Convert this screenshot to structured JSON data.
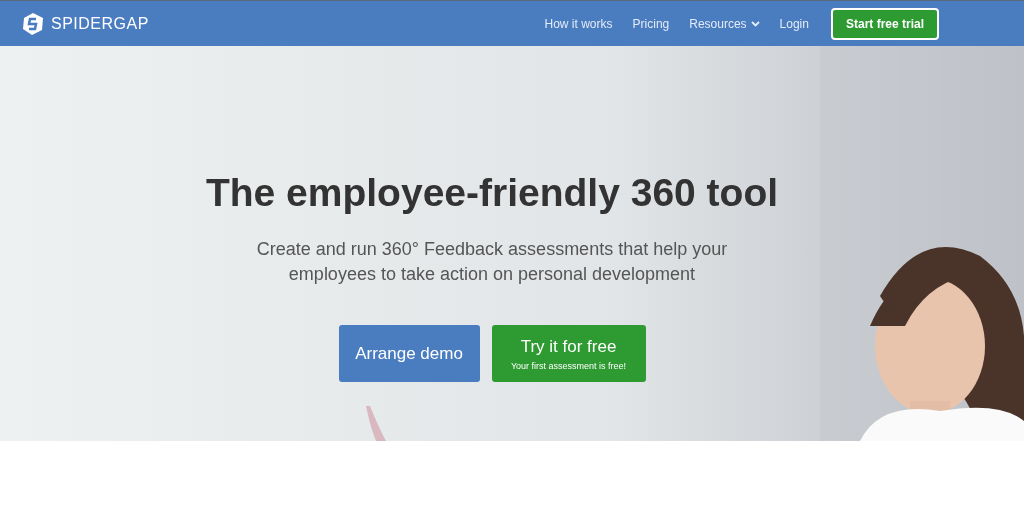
{
  "nav": {
    "logo": "SPIDERGAP",
    "links": [
      {
        "label": "How it works",
        "kind": "link"
      },
      {
        "label": "Pricing",
        "kind": "link"
      },
      {
        "label": "Resources",
        "kind": "dropdown"
      },
      {
        "label": "Login",
        "kind": "link"
      }
    ],
    "cta": "Start free trial"
  },
  "hero": {
    "title": "The employee-friendly 360 tool",
    "subtitle": "Create and run 360° Feedback assessments that help your employees to take action on personal development",
    "buttons": [
      {
        "label": "Arrange demo",
        "kind": "secondary"
      },
      {
        "label": "Try it for free",
        "note": "Your first assessment is free!",
        "kind": "primary"
      }
    ]
  }
}
